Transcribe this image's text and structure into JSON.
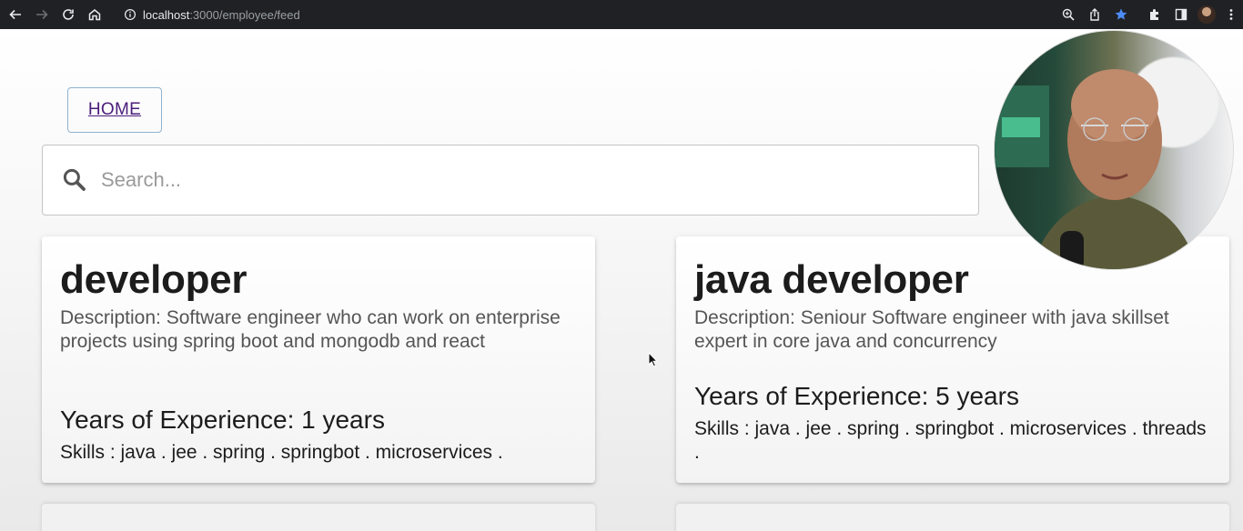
{
  "browser": {
    "url_host": "localhost",
    "url_rest": ":3000/employee/feed"
  },
  "nav": {
    "home_label": "HOME"
  },
  "search": {
    "placeholder": "Search..."
  },
  "posts": [
    {
      "title": "developer",
      "description": "Description: Software engineer who can work on enterprise projects using spring boot and mongodb and react",
      "experience": "Years of Experience: 1 years",
      "skills": "Skills : java . jee . spring . springbot . microservices ."
    },
    {
      "title": "java developer",
      "description": "Description: Seniour Software engineer with java skillset expert in core java and concurrency",
      "experience": "Years of Experience: 5 years",
      "skills": "Skills : java . jee . spring . springbot . microservices . threads ."
    }
  ],
  "colors": {
    "toolbar_bg": "#202124",
    "bookmark_star": "#4c8bf5",
    "home_link": "#4b1d7a",
    "home_border": "#8fb3d0"
  },
  "icons": [
    "back-icon",
    "forward-icon",
    "reload-icon",
    "home-icon",
    "info-icon",
    "zoom-icon",
    "share-icon",
    "star-icon",
    "extensions-icon",
    "sidepanel-icon",
    "profile-avatar",
    "menu-icon",
    "search-icon"
  ]
}
